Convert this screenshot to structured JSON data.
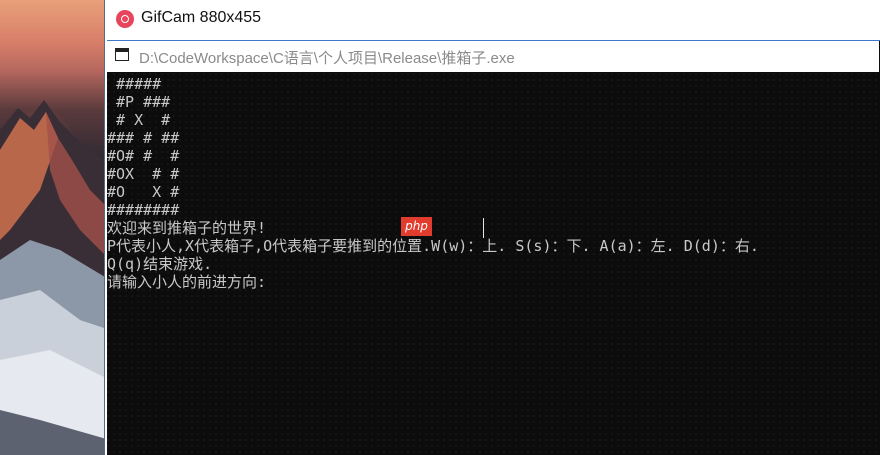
{
  "gifcam": {
    "title": "GifCam 880x455"
  },
  "console": {
    "path": "D:\\CodeWorkspace\\C语言\\个人项目\\Release\\推箱子.exe",
    "lines": [
      " #####",
      " #P ###",
      " # X  #",
      "### # ##",
      "#O# #  #",
      "#OX  # #",
      "#O   X #",
      "########",
      "欢迎来到推箱子的世界!",
      "P代表小人,X代表箱子,O代表箱子要推到的位置.W(w)：上. S(s)：下. A(a)：左. D(d)：右.",
      "Q(q)结束游戏.",
      "请输入小人的前进方向:"
    ]
  },
  "watermark": {
    "label": "php",
    "color": "#e13c2d"
  },
  "colors": {
    "console_background": "#0c0c0c",
    "console_text": "#c8c8c8",
    "gifcam_icon": "#e8455c"
  }
}
